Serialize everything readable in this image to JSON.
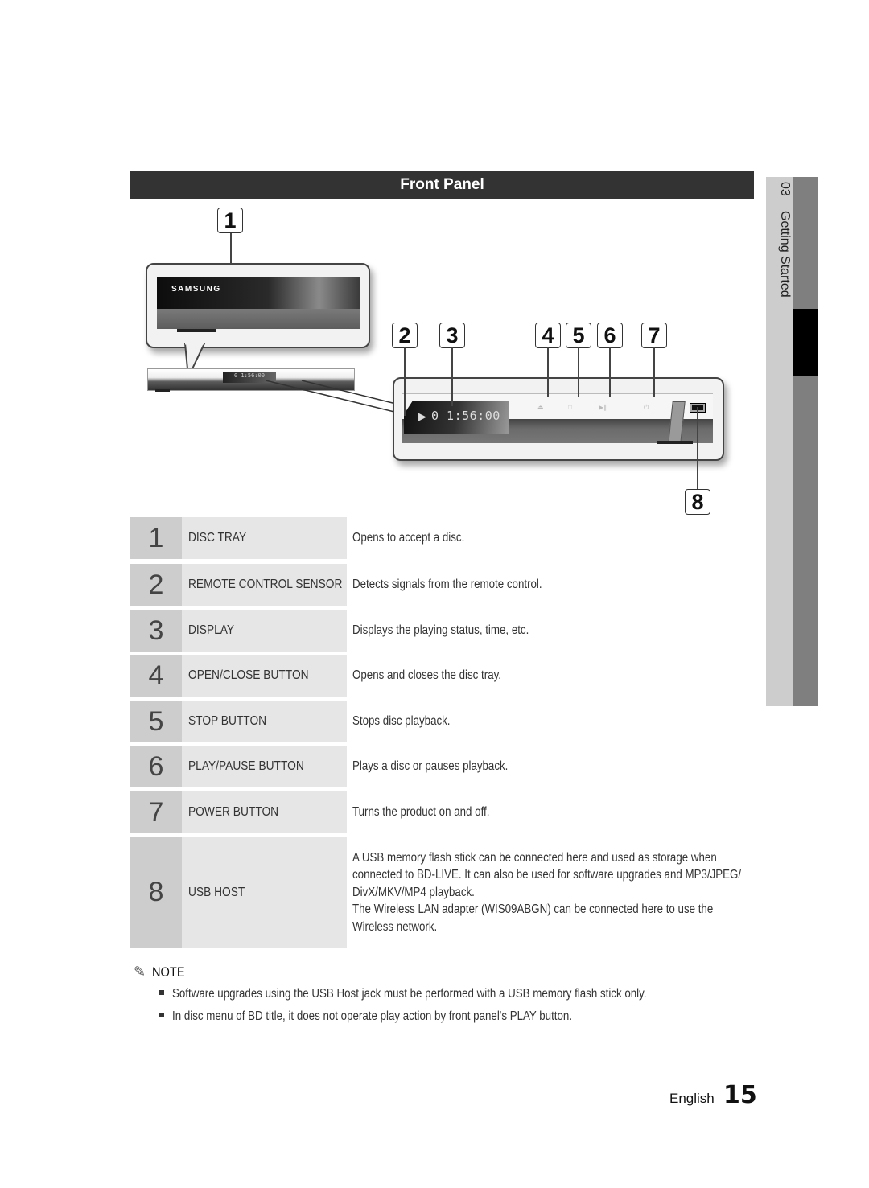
{
  "header": {
    "title": "Front Panel"
  },
  "side_tab": {
    "chapter_number": "03",
    "chapter_title": "Getting Started"
  },
  "diagram": {
    "brand_logo_text": "SAMSUNG",
    "display_readout": "0 1:56:00",
    "mini_display_readout": "0 1:56:00",
    "callouts": [
      "1",
      "2",
      "3",
      "4",
      "5",
      "6",
      "7",
      "8"
    ]
  },
  "table": {
    "rows": [
      {
        "number": "1",
        "name": "DISC TRAY",
        "description": "Opens to accept a disc."
      },
      {
        "number": "2",
        "name": "REMOTE CONTROL SENSOR",
        "description": "Detects signals from the remote control."
      },
      {
        "number": "3",
        "name": "DISPLAY",
        "description": "Displays the playing status, time, etc."
      },
      {
        "number": "4",
        "name": "OPEN/CLOSE BUTTON",
        "description": "Opens and closes the disc tray."
      },
      {
        "number": "5",
        "name": "STOP BUTTON",
        "description": "Stops disc playback."
      },
      {
        "number": "6",
        "name": "PLAY/PAUSE BUTTON",
        "description": "Plays a disc or pauses playback."
      },
      {
        "number": "7",
        "name": "POWER BUTTON",
        "description": "Turns the product on and off."
      },
      {
        "number": "8",
        "name": "USB HOST",
        "description_lines": [
          "A USB memory flash stick can be connected here and used as storage when",
          "connected to BD-LIVE. It can also be used for software upgrades and MP3/JPEG/",
          "DivX/MKV/MP4 playback.",
          "The Wireless LAN adapter (WIS09ABGN) can be connected here to use the",
          "Wireless network."
        ]
      }
    ]
  },
  "note": {
    "icon": "pencil-icon",
    "title": "NOTE",
    "items": [
      "Software upgrades using the USB Host jack must be performed with a USB memory flash stick only.",
      "In disc menu of BD title, it does not operate play action by front panel's PLAY button."
    ]
  },
  "footer": {
    "language": "English",
    "page_number": "15"
  }
}
